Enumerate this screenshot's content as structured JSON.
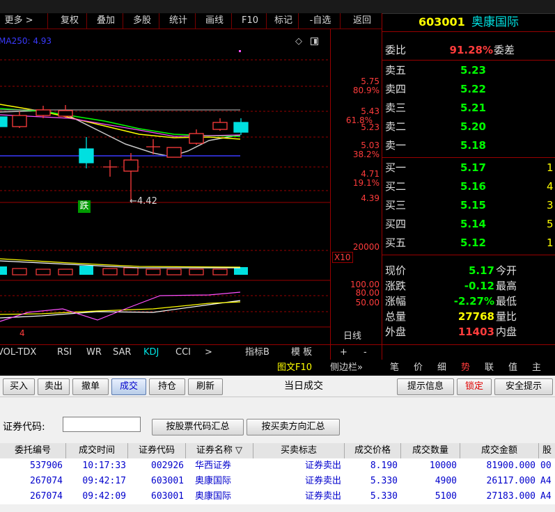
{
  "toolbar": {
    "items": [
      "更多 >",
      "复权",
      "叠加",
      "多股",
      "统计",
      "画线",
      "F10",
      "标记",
      "-自选",
      "返回"
    ]
  },
  "chart": {
    "ma_label": "MA250: 4.93",
    "low_annotation": "←4.42",
    "fall_badge": "跌",
    "price_ticks": [
      "5.75",
      "5.43",
      "5.23",
      "5.03",
      "4.71",
      "4.39"
    ],
    "pct_ticks": [
      "80.9%",
      "61.8%",
      "38.2%",
      "19.1%"
    ],
    "vol_tick": "20000",
    "vol_multiplier": "X10",
    "kdj_ticks": [
      "100.00",
      "80.00",
      "50.00"
    ],
    "period_label": "日线",
    "sub_index": "4"
  },
  "indicator_tabs": {
    "items": [
      "VOL-TDX",
      "RSI",
      "WR",
      "SAR",
      "KDJ",
      "CCI",
      ">"
    ],
    "active": "KDJ",
    "right": [
      "指标B",
      "模 板",
      "+",
      "-"
    ]
  },
  "side_toggle": {
    "f10": "图文F10",
    "sidebar": "侧边栏»"
  },
  "quote": {
    "code": "603001",
    "name": "奥康国际",
    "weibi_label": "委比",
    "weibi_value": "91.28%",
    "weicha_label": "委差",
    "asks": [
      {
        "label": "卖五",
        "price": "5.23"
      },
      {
        "label": "卖四",
        "price": "5.22"
      },
      {
        "label": "卖三",
        "price": "5.21"
      },
      {
        "label": "卖二",
        "price": "5.20"
      },
      {
        "label": "卖一",
        "price": "5.18"
      }
    ],
    "bids": [
      {
        "label": "买一",
        "price": "5.17",
        "vol": "1"
      },
      {
        "label": "买二",
        "price": "5.16",
        "vol": "4"
      },
      {
        "label": "买三",
        "price": "5.15",
        "vol": "3"
      },
      {
        "label": "买四",
        "price": "5.14",
        "vol": "5"
      },
      {
        "label": "买五",
        "price": "5.12",
        "vol": "1"
      }
    ],
    "stats": [
      {
        "label": "现价",
        "value": "5.17",
        "label2": "今开"
      },
      {
        "label": "涨跌",
        "value": "-0.12",
        "label2": "最高"
      },
      {
        "label": "涨幅",
        "value": "-2.27%",
        "label2": "最低"
      },
      {
        "label": "总量",
        "value": "27768",
        "label2": "量比"
      },
      {
        "label": "外盘",
        "value": "11403",
        "label2": "内盘"
      }
    ],
    "tabs": [
      "笔",
      "价",
      "细",
      "势",
      "联",
      "值",
      "主"
    ],
    "active_tab": "势"
  },
  "trade": {
    "buttons": [
      "买入",
      "卖出",
      "撤单",
      "成交",
      "持仓",
      "刷新"
    ],
    "active_button": "成交",
    "title": "当日成交",
    "right_buttons": [
      "提示信息",
      "锁定",
      "安全提示"
    ],
    "code_label": "证券代码:",
    "code_placeholder": "",
    "summary_buttons": [
      "按股票代码汇总",
      "按买卖方向汇总"
    ],
    "headers": [
      "委托编号",
      "成交时间",
      "证券代码",
      "证券名称 ▽",
      "买卖标志",
      "成交价格",
      "成交数量",
      "成交金额",
      "股"
    ],
    "rows": [
      [
        "537906",
        "10:17:33",
        "002926",
        "华西证券",
        "证券卖出",
        "8.190",
        "10000",
        "81900.000",
        "00"
      ],
      [
        "267074",
        "09:42:17",
        "603001",
        "奥康国际",
        "证券卖出",
        "5.330",
        "4900",
        "26117.000",
        "A4"
      ],
      [
        "267074",
        "09:42:09",
        "603001",
        "奥康国际",
        "证券卖出",
        "5.330",
        "5100",
        "27183.000",
        "A4"
      ]
    ]
  },
  "colors": {
    "up": "#ff3c3c",
    "down": "#00e0e0",
    "yellow": "#ffff00",
    "green": "#00ff00",
    "grid": "#9a0000"
  }
}
